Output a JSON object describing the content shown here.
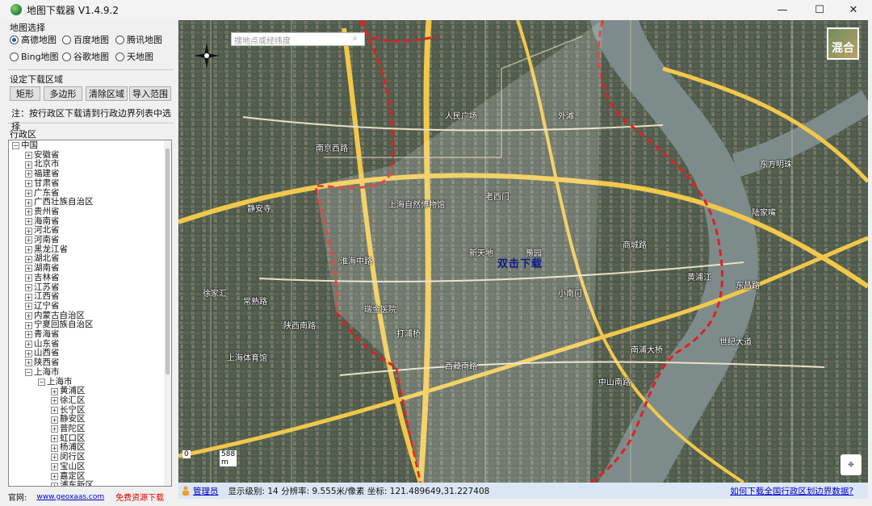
{
  "window": {
    "title": "地图下载器 V1.4.9.2",
    "min": "—",
    "max": "☐",
    "close": "✕"
  },
  "map_select": {
    "label": "地图选择",
    "options": [
      "高德地图",
      "百度地图",
      "腾讯地图",
      "Bing地图",
      "谷歌地图",
      "天地图"
    ],
    "selected": "高德地图"
  },
  "download_area": {
    "label": "设定下载区域",
    "buttons": [
      "矩形",
      "多边形",
      "清除区域",
      "导入范围"
    ],
    "note": "注：按行政区下载请到行政边界列表中选择"
  },
  "admin_tree": {
    "label": "行政区",
    "root": "中国",
    "provinces": [
      "安徽省",
      "北京市",
      "福建省",
      "甘肃省",
      "广东省",
      "广西壮族自治区",
      "贵州省",
      "海南省",
      "河北省",
      "河南省",
      "黑龙江省",
      "湖北省",
      "湖南省",
      "吉林省",
      "江苏省",
      "江西省",
      "辽宁省",
      "内蒙古自治区",
      "宁夏回族自治区",
      "青海省",
      "山东省",
      "山西省",
      "陕西省",
      "上海市"
    ],
    "expanded_province": "上海市",
    "city": "上海市",
    "districts": [
      "黄浦区",
      "徐汇区",
      "长宁区",
      "静安区",
      "普陀区",
      "虹口区",
      "杨浦区",
      "闵行区",
      "宝山区",
      "嘉定区",
      "浦东新区"
    ]
  },
  "footer": {
    "site_label": "官网:",
    "site": "www.geoxaas.com",
    "free": "免费资源下载"
  },
  "map": {
    "search_placeholder": "搜地点或经纬度",
    "layer_label": "混合",
    "overlay": "双击下载",
    "scale_left": "0",
    "scale_right": "588 m",
    "labels": [
      {
        "t": "人民广场"
      },
      {
        "t": "南京西路"
      },
      {
        "t": "上海自然博物馆"
      },
      {
        "t": "静安寺"
      },
      {
        "t": "老西门"
      },
      {
        "t": "新天地"
      },
      {
        "t": "豫园"
      },
      {
        "t": "小南门"
      },
      {
        "t": "陆家嘴"
      },
      {
        "t": "东昌路"
      },
      {
        "t": "世纪大道"
      },
      {
        "t": "商城路"
      },
      {
        "t": "徐家汇"
      },
      {
        "t": "上海体育馆"
      },
      {
        "t": "打浦桥"
      },
      {
        "t": "南浦大桥"
      },
      {
        "t": "西藏南路"
      },
      {
        "t": "东方明珠"
      },
      {
        "t": "外滩"
      },
      {
        "t": "淮海中路"
      },
      {
        "t": "陕西南路"
      },
      {
        "t": "常熟路"
      },
      {
        "t": "瑞金医院"
      },
      {
        "t": "中山南路"
      },
      {
        "t": "黄浦江"
      }
    ]
  },
  "status": {
    "admin": "管理员",
    "info": "显示级别: 14 分辨率: 9.555米/像素 坐标: 121.489649,31.227408",
    "help": "如何下载全国行政区划边界数据?"
  },
  "colors": {
    "boundary": "#e02020",
    "road": "#f0c040",
    "river": "#8a9a9a",
    "status_bg": "#dbe6f4"
  }
}
